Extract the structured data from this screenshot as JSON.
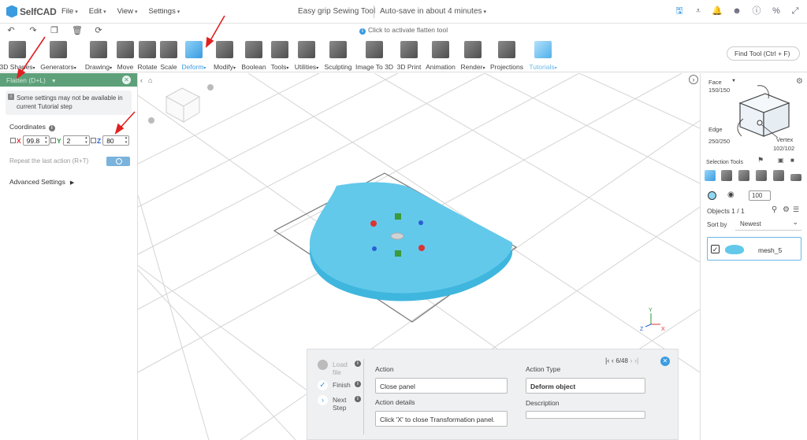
{
  "app": {
    "name": "SelfCAD",
    "doc_title": "Easy grip Sewing Tool",
    "autosave": "Auto-save in about 4 minutes",
    "menu": [
      "File",
      "Edit",
      "View",
      "Settings"
    ]
  },
  "hint": "Click to activate flatten tool",
  "toolbar": {
    "tools": [
      {
        "label": "3D Shapes",
        "dropdown": true
      },
      {
        "label": "Generators",
        "dropdown": true
      },
      {
        "label": "Drawing",
        "dropdown": true
      },
      {
        "label": "Move",
        "dropdown": false
      },
      {
        "label": "Rotate",
        "dropdown": false
      },
      {
        "label": "Scale",
        "dropdown": false
      },
      {
        "label": "Deform",
        "dropdown": true
      },
      {
        "label": "Modify",
        "dropdown": true
      },
      {
        "label": "Boolean",
        "dropdown": false
      },
      {
        "label": "Tools",
        "dropdown": true
      },
      {
        "label": "Utilities",
        "dropdown": true
      },
      {
        "label": "Sculpting",
        "dropdown": false
      },
      {
        "label": "Image To 3D",
        "dropdown": false
      },
      {
        "label": "3D Print",
        "dropdown": false
      },
      {
        "label": "Animation",
        "dropdown": false
      },
      {
        "label": "Render",
        "dropdown": true
      },
      {
        "label": "Projections",
        "dropdown": false
      },
      {
        "label": "Tutorials",
        "dropdown": true
      }
    ],
    "find_tool": "Find Tool (Ctrl + F)"
  },
  "left_panel": {
    "header": "Flatten (D+L)",
    "warning": "Some settings may not be available in current Tutorial step",
    "coordinates_label": "Coordinates",
    "x": {
      "label": "X",
      "value": "99.8"
    },
    "y": {
      "label": "Y",
      "value": "2"
    },
    "z": {
      "label": "Z",
      "value": "80"
    },
    "repeat_label": "Repeat the last action (R+T)",
    "advanced_label": "Advanced Settings"
  },
  "right_panel": {
    "face_label": "Face",
    "face_count": "150/150",
    "edge_label": "Edge",
    "edge_count": "250/250",
    "vertex_label": "Vertex",
    "vertex_count": "102/102",
    "selection_tools_label": "Selection Tools",
    "opacity_value": "100",
    "objects_label": "Objects 1 / 1",
    "sort_label": "Sort by",
    "sort_value": "Newest",
    "objects": [
      {
        "name": "mesh_5",
        "checked": true
      }
    ]
  },
  "tutorial": {
    "steps": [
      {
        "label": "Load file",
        "state": "pending"
      },
      {
        "label": "Finish",
        "state": "done"
      },
      {
        "label": "Next Step",
        "state": "next"
      }
    ],
    "action_label": "Action",
    "action_value": "Close panel",
    "action_details_label": "Action details",
    "action_details_value": "Click 'X' to close Transformation panel.",
    "action_type_label": "Action Type",
    "action_type_value": "Deform object",
    "description_label": "Description",
    "description_value": "",
    "progress": "6/48"
  },
  "colors": {
    "accent": "#3a9be0",
    "panel_header": "#5ea07a",
    "mesh": "#63c9ea",
    "annotation_arrow": "#e02020"
  }
}
